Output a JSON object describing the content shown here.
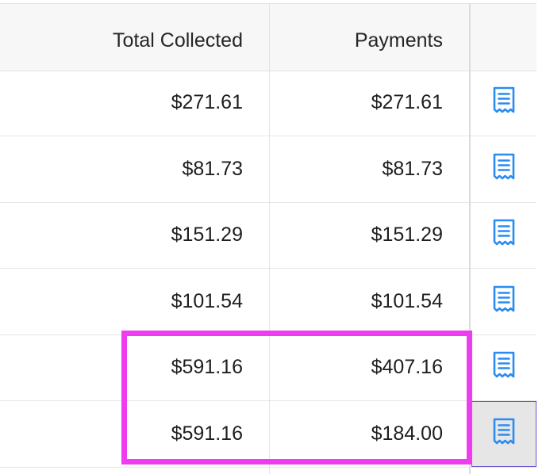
{
  "columns": {
    "total_collected": "Total Collected",
    "payments": "Payments"
  },
  "rows": [
    {
      "total_collected": "$271.61",
      "payments": "$271.61",
      "icon": "receipt-icon"
    },
    {
      "total_collected": "$81.73",
      "payments": "$81.73",
      "icon": "receipt-icon"
    },
    {
      "total_collected": "$151.29",
      "payments": "$151.29",
      "icon": "receipt-icon"
    },
    {
      "total_collected": "$101.54",
      "payments": "$101.54",
      "icon": "receipt-icon"
    },
    {
      "total_collected": "$591.16",
      "payments": "$407.16",
      "icon": "receipt-icon"
    },
    {
      "total_collected": "$591.16",
      "payments": "$184.00",
      "icon": "receipt-icon",
      "selected": true
    }
  ],
  "colors": {
    "accent_icon": "#2a8cf0",
    "highlight_border": "#f03cf0",
    "selected_border": "#6b55c9"
  }
}
